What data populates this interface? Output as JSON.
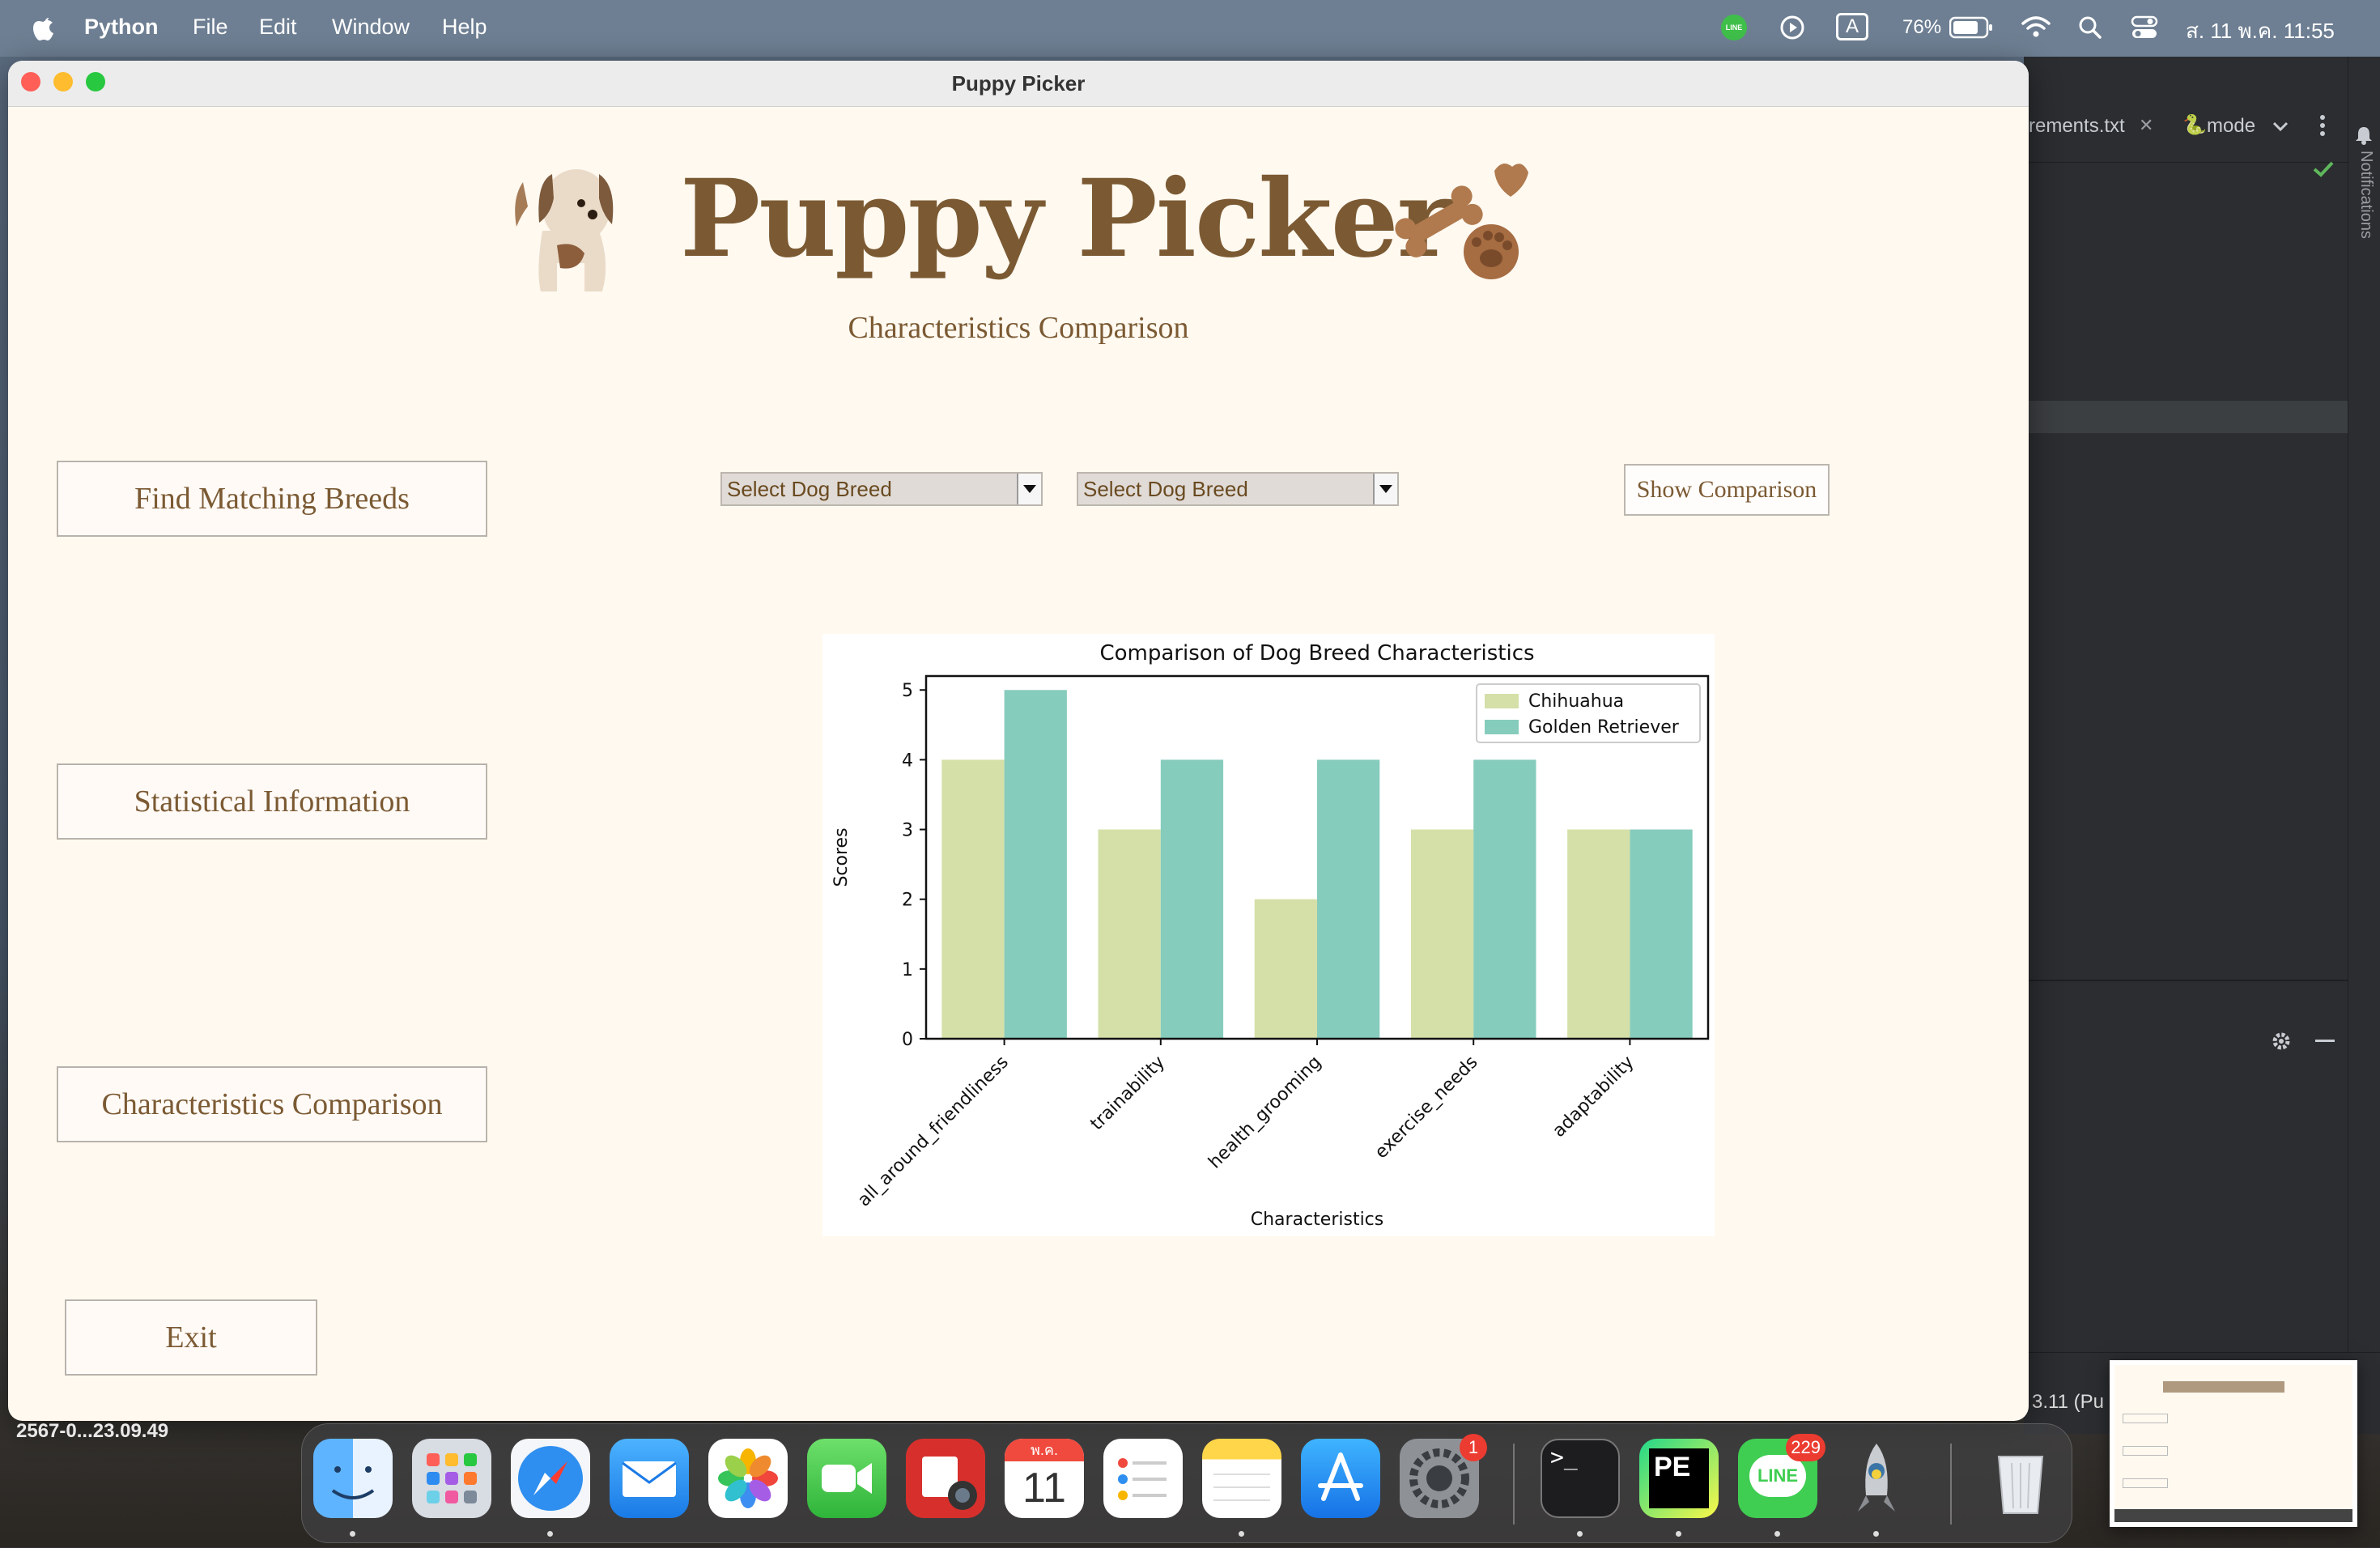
{
  "menubar": {
    "app_name": "Python",
    "items": [
      "File",
      "Edit",
      "Window",
      "Help"
    ],
    "input_indicator": "A",
    "battery_percent": "76%",
    "datetime": "ส. 11 พ.ค.  11:55",
    "line_label": "LINE"
  },
  "window": {
    "title": "Puppy Picker",
    "header_title": "Puppy Picker",
    "header_subtitle": "Characteristics Comparison",
    "side_buttons": [
      "Find Matching Breeds",
      "Statistical Information",
      "Characteristics Comparison"
    ],
    "exit_label": "Exit",
    "dropdown1_value": "Select Dog Breed",
    "dropdown2_value": "Select Dog Breed",
    "show_button": "Show Comparison"
  },
  "chart_data": {
    "type": "bar",
    "title": "Comparison of Dog Breed Characteristics",
    "xlabel": "Characteristics",
    "ylabel": "Scores",
    "categories": [
      "all_around_friendliness",
      "trainability",
      "health_grooming",
      "exercise_needs",
      "adaptability"
    ],
    "series": [
      {
        "name": "Chihuahua",
        "values": [
          4,
          3,
          2,
          3,
          3
        ],
        "color": "#d4e0a8"
      },
      {
        "name": "Golden Retriever",
        "values": [
          5,
          4,
          4,
          4,
          3
        ],
        "color": "#86ccbc"
      }
    ],
    "ylim": [
      0,
      5.2
    ],
    "yticks": [
      0,
      1,
      2,
      3,
      4,
      5
    ],
    "legend": "top-right",
    "grid": false
  },
  "ide": {
    "tab1": "rements.txt",
    "tab2": "mode",
    "sidebar_label": "Notifications",
    "status_text": "3.11 (Pu"
  },
  "desktop": {
    "file_label": "2567-0...23.09.49"
  },
  "dock": {
    "calendar_month": "พ.ค.",
    "calendar_day": "11",
    "settings_badge": "1",
    "line_badge": "229",
    "line_label": "LINE",
    "pe_label": "PE",
    "terminal_label": ">_"
  },
  "colors": {
    "brand_brown": "#7b5a33",
    "window_bg": "#fff9f0"
  }
}
